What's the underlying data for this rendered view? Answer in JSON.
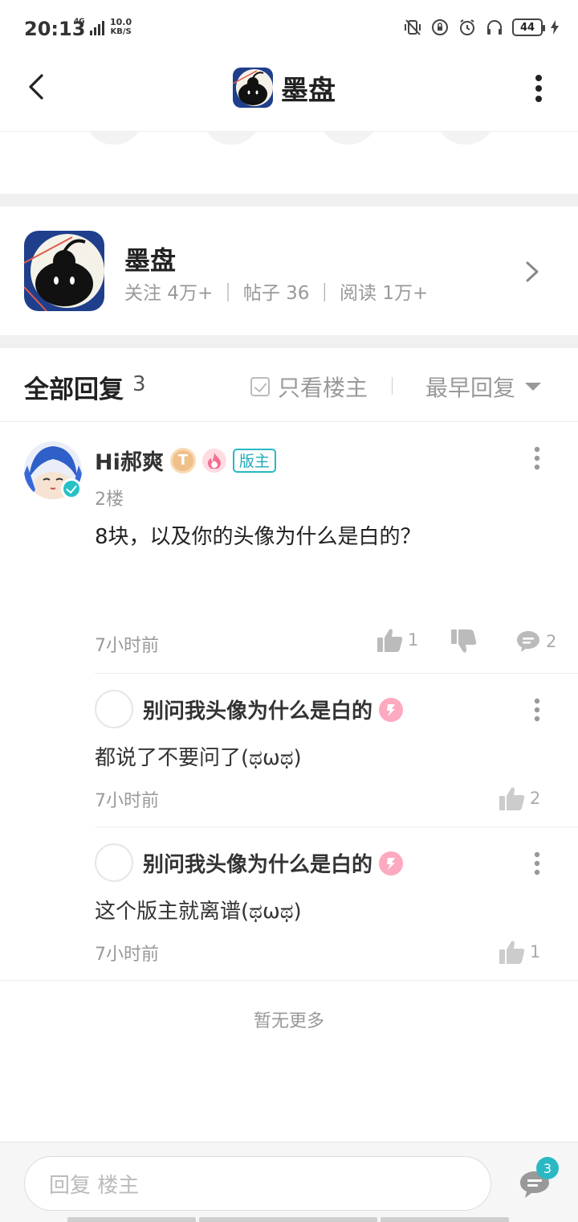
{
  "status_bar": {
    "time": "20:13",
    "network": "4G",
    "speed_value": "10.0",
    "speed_unit": "KB/S",
    "battery": "44"
  },
  "nav": {
    "title": "墨盘"
  },
  "forum": {
    "name": "墨盘",
    "stats": "关注 4万+ ｜ 帖子 36 ｜ 阅读 1万+"
  },
  "replies_header": {
    "title": "全部回复",
    "count": "3",
    "only_op_label": "只看楼主",
    "sort_label": "最早回复"
  },
  "post": {
    "username": "Hi郝爽",
    "coin_badge": "T",
    "mod_badge": "版主",
    "floor": "2楼",
    "content": "8块，以及你的头像为什么是白的？",
    "time": "7小时前",
    "likes": "1",
    "comments": "2"
  },
  "sub_replies": [
    {
      "username": "别问我头像为什么是白的",
      "content": "都说了不要问了(ಥωಥ)",
      "time": "7小时前",
      "likes": "2"
    },
    {
      "username": "别问我头像为什么是白的",
      "content": "这个版主就离谱(ಥωಥ)",
      "time": "7小时前",
      "likes": "1"
    }
  ],
  "no_more_text": "暂无更多",
  "bottom_bar": {
    "reply_placeholder": "回复  楼主",
    "comment_count": "3"
  },
  "icons": {
    "back": "chevron-left-icon",
    "more": "more-vertical-icon",
    "forum_arrow": "chevron-right-icon",
    "like": "thumbs-up-icon",
    "dislike": "thumbs-down-icon",
    "comment": "comment-icon"
  },
  "colors": {
    "accent": "#27b8c4",
    "muted_text": "#999999",
    "section_gap": "#f0f0f0"
  }
}
